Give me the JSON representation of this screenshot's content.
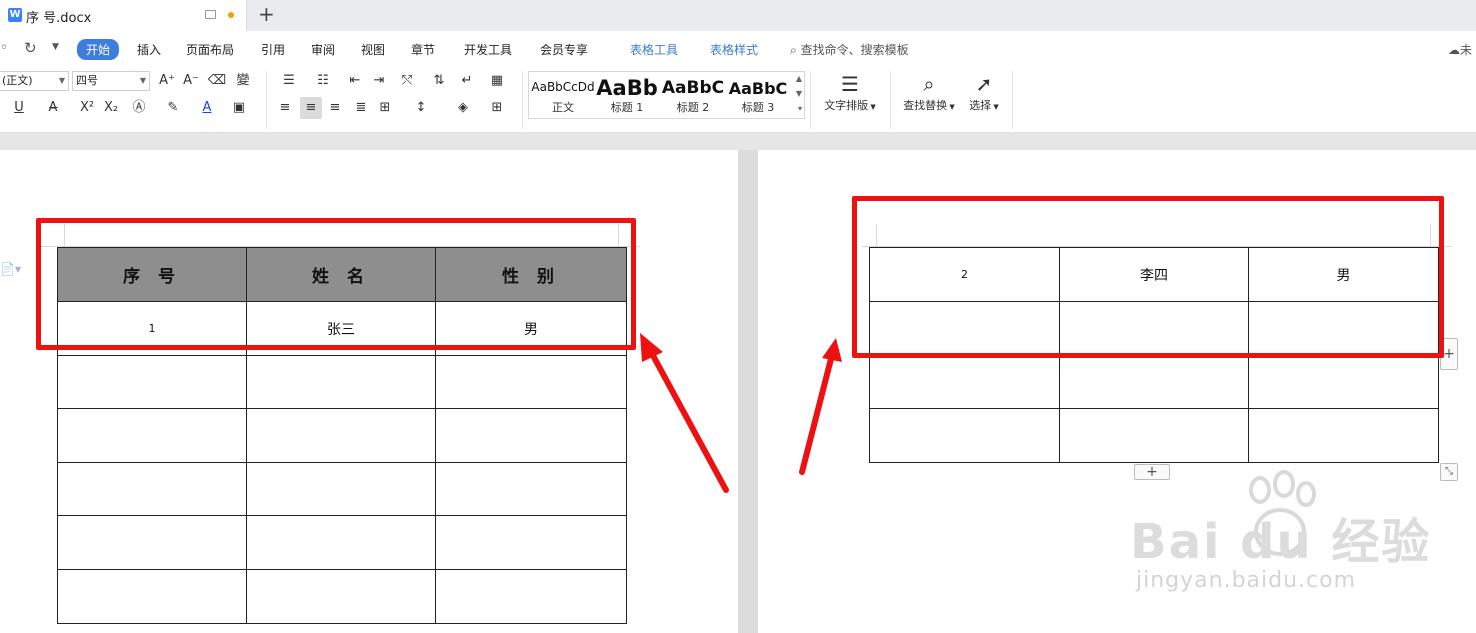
{
  "titlebar": {
    "doc_icon_letter": "W",
    "document_title": "序 号.docx",
    "new_tab": "+"
  },
  "menu": {
    "redo_glyph": "↻",
    "items": [
      "开始",
      "插入",
      "页面布局",
      "引用",
      "审阅",
      "视图",
      "章节",
      "开发工具",
      "会员专享"
    ],
    "active": "开始",
    "context_tabs": [
      "表格工具",
      "表格样式"
    ],
    "search_placeholder": "查找命令、搜索模板",
    "cloud_label": "未"
  },
  "ribbon": {
    "font_name": "(正文)",
    "font_size": "四号",
    "styles": [
      {
        "sample": "AaBbCcDd",
        "name": "正文"
      },
      {
        "sample": "AaBb",
        "name": "标题 1"
      },
      {
        "sample": "AaBbC",
        "name": "标题 2"
      },
      {
        "sample": "AaBbC",
        "name": "标题 3"
      }
    ],
    "text_layout_label": "文字排版",
    "find_replace_label": "查找替换",
    "select_label": "选择"
  },
  "left_table": {
    "headers": [
      "序 号",
      "姓 名",
      "性 别"
    ],
    "rows": [
      [
        "1",
        "张三",
        "男"
      ],
      [
        "",
        "",
        ""
      ],
      [
        "",
        "",
        ""
      ],
      [
        "",
        "",
        ""
      ],
      [
        "",
        "",
        ""
      ],
      [
        "",
        "",
        ""
      ]
    ]
  },
  "right_table": {
    "rows": [
      [
        "2",
        "李四",
        "男"
      ],
      [
        "",
        "",
        ""
      ],
      [
        "",
        "",
        ""
      ],
      [
        "",
        "",
        ""
      ]
    ]
  },
  "table_add_button": "+",
  "watermark": {
    "brand": "Bai du 经验",
    "url": "jingyan.baidu.com"
  },
  "colors": {
    "accent": "#3f7ddc",
    "highlight_box": "#ee1111",
    "header_fill": "#8e8e8e"
  }
}
